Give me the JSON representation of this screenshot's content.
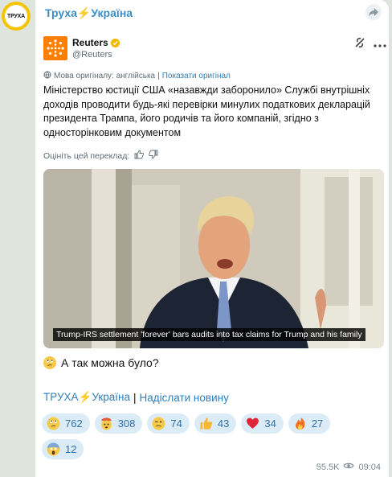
{
  "channel": {
    "avatar_text": "ТРУХА",
    "name_prefix": "Труха",
    "bolt": "⚡",
    "name_suffix": "Україна"
  },
  "tweet": {
    "author_name": "Reuters",
    "author_handle": "@Reuters",
    "language_label": "Мова оригіналу: англійська",
    "separator": "|",
    "show_original": "Показати оригінал",
    "text": "Міністерство юстиції США «назавжди заборонило» Службі внутрішніх доходів проводити будь-які перевірки минулих податкових декларацій президента Трампа, його родичів та його компаній, згідно з односторінковим документом",
    "rate_translation": "Оцініть цей переклад:"
  },
  "photo": {
    "caption": "Trump-IRS settlement 'forever' bars audits into tax claims for Trump and his family"
  },
  "post": {
    "text": "А так можна було?"
  },
  "footer": {
    "link1_prefix": "ТРУХА",
    "bolt": "⚡",
    "link1_suffix": "Україна",
    "pipe": "|",
    "link2": "Надіслати новину"
  },
  "reactions": [
    {
      "icon": "face-eye-roll-icon",
      "count": "762"
    },
    {
      "icon": "face-exploding-head-icon",
      "count": "308"
    },
    {
      "icon": "face-zany-icon",
      "count": "74"
    },
    {
      "icon": "thumbs-up-icon",
      "count": "43"
    },
    {
      "icon": "heart-icon",
      "count": "34"
    },
    {
      "icon": "fire-icon",
      "count": "27"
    },
    {
      "icon": "face-screaming-icon",
      "count": "12"
    }
  ],
  "meta": {
    "views": "55.5K",
    "time": "09:04"
  },
  "colors": {
    "accent": "#2f7fb8",
    "channel": "#3a8ec7",
    "reaction_bg": "#dbecf6",
    "brand_yellow": "#f5c400",
    "reuters_orange": "#ff8000"
  }
}
